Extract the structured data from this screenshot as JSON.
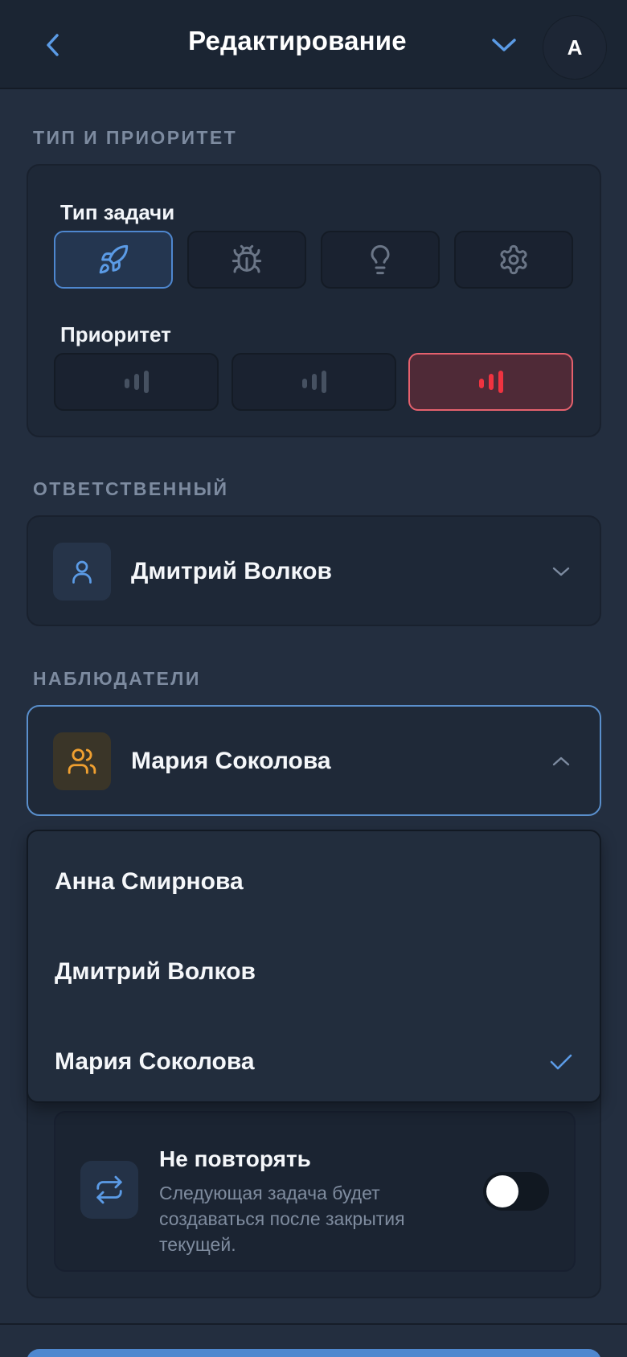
{
  "header": {
    "title": "Редактирование",
    "avatar_initial": "A"
  },
  "type_priority": {
    "section_label": "ТИП И ПРИОРИТЕТ",
    "type_label": "Тип задачи",
    "type_options": [
      {
        "icon": "rocket-icon",
        "selected": true
      },
      {
        "icon": "bug-icon",
        "selected": false
      },
      {
        "icon": "lightbulb-icon",
        "selected": false
      },
      {
        "icon": "gear-icon",
        "selected": false
      }
    ],
    "priority_label": "Приоритет",
    "priority_options": [
      {
        "icon": "priority-bars-icon",
        "selected": false
      },
      {
        "icon": "priority-bars-icon",
        "selected": false
      },
      {
        "icon": "priority-bars-icon",
        "selected": true
      }
    ]
  },
  "assignee": {
    "section_label": "ОТВЕТСТВЕННЫЙ",
    "value": "Дмитрий Волков",
    "icon": "user-icon"
  },
  "watchers": {
    "section_label": "НАБЛЮДАТЕЛИ",
    "value": "Мария Соколова",
    "icon": "users-icon",
    "options": [
      {
        "label": "Анна Смирнова",
        "selected": false
      },
      {
        "label": "Дмитрий Волков",
        "selected": false
      },
      {
        "label": "Мария Соколова",
        "selected": true
      }
    ]
  },
  "repeat": {
    "title": "Не повторять",
    "description": "Следующая задача будет создаваться после закрытия текущей.",
    "icon": "repeat-icon",
    "enabled": false
  },
  "colors": {
    "accent": "#5b9be6",
    "priority_high": "#ef3340",
    "watchers_icon": "#f0a030"
  }
}
